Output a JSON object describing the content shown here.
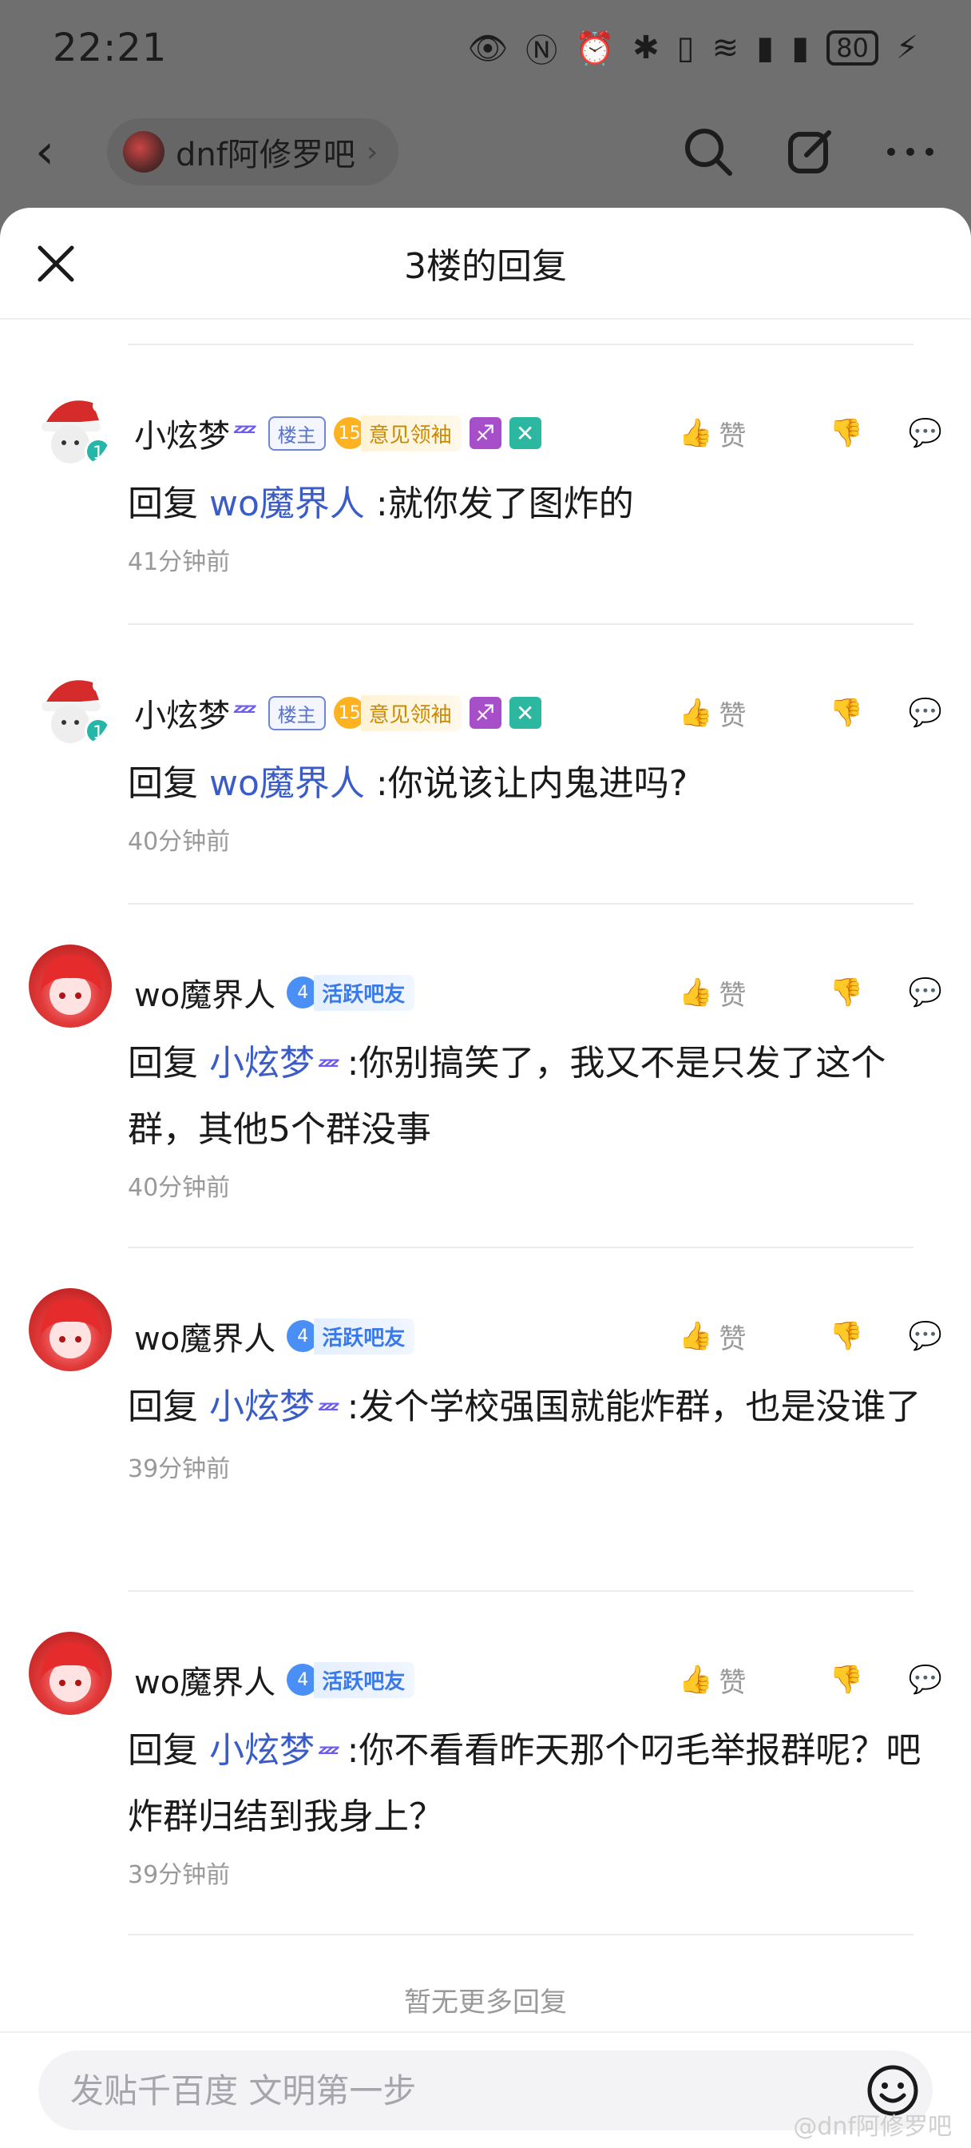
{
  "status": {
    "time": "22:21",
    "battery": "80"
  },
  "nav": {
    "forum_name": "dnf阿修罗吧"
  },
  "sheet": {
    "title": "3楼的回复"
  },
  "replies": [
    {
      "user": "小炫梦",
      "owner_badge": "楼主",
      "level": "15",
      "title": "意见领袖",
      "text_prefix": "回复",
      "mention": "wo魔界人",
      "text": " :就你发了图炸的",
      "time": "41分钟前",
      "like_label": "赞"
    },
    {
      "user": "小炫梦",
      "owner_badge": "楼主",
      "level": "15",
      "title": "意见领袖",
      "text_prefix": "回复",
      "mention": "wo魔界人",
      "text": " :你说该让内鬼进吗?",
      "time": "40分钟前",
      "like_label": "赞"
    },
    {
      "user": "wo魔界人",
      "level": "4",
      "title": "活跃吧友",
      "text_prefix": "回复",
      "mention": "小炫梦",
      "text": " :你别搞笑了，我又不是只发了这个群，其他5个群没事",
      "time": "40分钟前",
      "like_label": "赞"
    },
    {
      "user": "wo魔界人",
      "level": "4",
      "title": "活跃吧友",
      "text_prefix": "回复",
      "mention": "小炫梦",
      "text": " :发个学校强国就能炸群，也是没谁了",
      "time": "39分钟前",
      "like_label": "赞"
    },
    {
      "user": "wo魔界人",
      "level": "4",
      "title": "活跃吧友",
      "text_prefix": "回复",
      "mention": "小炫梦",
      "text": " :你不看看昨天那个叼毛举报群呢？吧炸群归结到我身上？",
      "time": "39分钟前",
      "like_label": "赞"
    }
  ],
  "no_more": "暂无更多回复",
  "input": {
    "placeholder": "发贴千百度 文明第一步"
  },
  "watermark": "@dnf阿修罗吧",
  "colors": {
    "mention": "#3a5cc8",
    "owner_badge": "#5b72c9",
    "gold": "#cb8a00",
    "active_blue": "#3a7ae8"
  }
}
